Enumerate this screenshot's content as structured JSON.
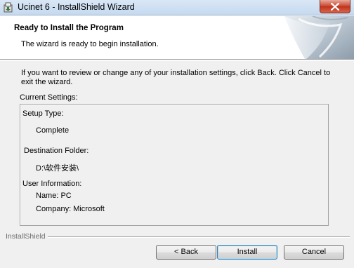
{
  "window": {
    "title": "Ucinet 6 - InstallShield Wizard",
    "close_symbol": "×"
  },
  "header": {
    "title": "Ready to Install the Program",
    "subtitle": "The wizard is ready to begin installation."
  },
  "intro": "If you want to review or change any of your installation settings, click Back. Click Cancel to exit the wizard.",
  "current_settings_label": "Current Settings:",
  "settings": {
    "setup_type_label": "Setup Type:",
    "setup_type_value": "Complete",
    "destination_label": "Destination Folder:",
    "destination_value": "D:\\软件安装\\",
    "user_info_label": "User Information:",
    "name_text": "Name: PC",
    "company_text": "Company: Microsoft"
  },
  "brand": "InstallShield",
  "buttons": {
    "back": "< Back",
    "install": "Install",
    "cancel": "Cancel"
  },
  "icons": {
    "title_icon": "installer-icon",
    "header_art": "page-curl-icon"
  },
  "colors": {
    "dialog_bg": "#f0f0f0",
    "header_bg": "#ffffff",
    "titlebar": "#c5d9ef",
    "close_button": "#c8452e",
    "default_button_border": "#3c7fb1"
  }
}
